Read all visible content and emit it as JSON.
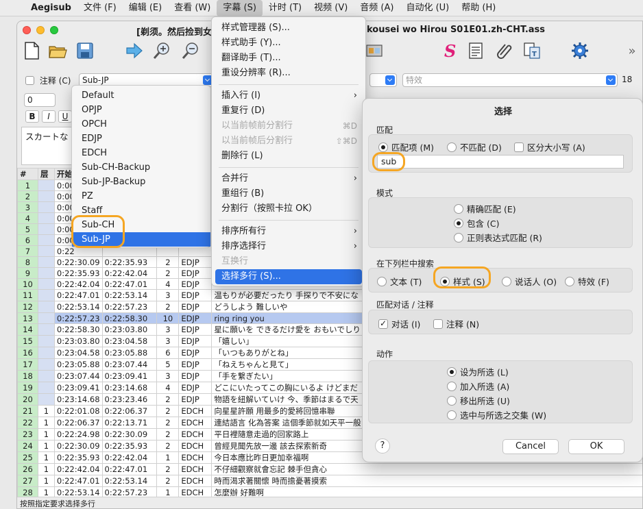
{
  "menubar": {
    "items": [
      "Aegisub",
      "文件 (F)",
      "编辑 (E)",
      "查看 (W)",
      "字幕 (S)",
      "计时 (T)",
      "视频 (V)",
      "音频 (A)",
      "自动化 (U)",
      "帮助 (H)"
    ]
  },
  "window": {
    "title_left": "[剃须。然后捡到女",
    "title_right": "kousei wo Hirou S01E01.zh-CHT.ass"
  },
  "editor": {
    "comment_label": "注释 (C)",
    "style_value": "Sub-JP",
    "effect_placeholder": "特效",
    "margin_value": "18",
    "layer_value": "0",
    "bold_label": "B",
    "italic_label": "I",
    "underline_label": "U",
    "text_preview": "スカートな"
  },
  "style_dropdown": {
    "options": [
      "Default",
      "OPJP",
      "OPCH",
      "EDJP",
      "EDCH",
      "Sub-CH-Backup",
      "Sub-JP-Backup",
      "PZ",
      "Staff",
      "Sub-CH",
      "Sub-JP"
    ],
    "selected": "Sub-JP"
  },
  "subtitle_menu": {
    "items": [
      {
        "label": "样式管理器 (S)..."
      },
      {
        "label": "样式助手 (Y)..."
      },
      {
        "label": "翻译助手 (T)..."
      },
      {
        "label": "重设分辨率 (R)..."
      },
      {
        "label": "插入行 (I)"
      },
      {
        "label": "重复行 (D)"
      },
      {
        "label": "以当前帧前分割行",
        "shortcut": "⌘D"
      },
      {
        "label": "以当前帧后分割行",
        "shortcut": "⇧⌘D"
      },
      {
        "label": "删除行 (L)"
      },
      {
        "label": "合并行"
      },
      {
        "label": "重组行 (B)"
      },
      {
        "label": "分割行（按照卡拉 OK）"
      },
      {
        "label": "排序所有行"
      },
      {
        "label": "排序选择行"
      },
      {
        "label": "互换行"
      },
      {
        "label": "选择多行 (S)..."
      }
    ]
  },
  "grid": {
    "headers": [
      "#",
      "层",
      "开始"
    ],
    "rows": [
      {
        "n": "1",
        "layer": "",
        "start": "0:00",
        "end": "",
        "dur": "",
        "style": "",
        "text": ""
      },
      {
        "n": "2",
        "layer": "",
        "start": "0:00",
        "end": "",
        "dur": "",
        "style": "",
        "text": ""
      },
      {
        "n": "3",
        "layer": "",
        "start": "0:00",
        "end": "",
        "dur": "",
        "style": "",
        "text": ""
      },
      {
        "n": "4",
        "layer": "",
        "start": "0:00",
        "end": "",
        "dur": "",
        "style": "",
        "text": ""
      },
      {
        "n": "5",
        "layer": "",
        "start": "0:00",
        "end": "",
        "dur": "",
        "style": "",
        "text": ""
      },
      {
        "n": "6",
        "layer": "",
        "start": "0:00",
        "end": "",
        "dur": "",
        "style": "",
        "text": ""
      },
      {
        "n": "7",
        "layer": "",
        "start": "0:22",
        "end": "",
        "dur": "",
        "style": "",
        "text": ""
      },
      {
        "n": "8",
        "layer": "",
        "start": "0:22:30.09",
        "end": "0:22:35.93",
        "dur": "2",
        "style": "EDJP",
        "text": ""
      },
      {
        "n": "9",
        "layer": "",
        "start": "0:22:35.93",
        "end": "0:22:42.04",
        "dur": "2",
        "style": "EDJP",
        "text": ""
      },
      {
        "n": "10",
        "layer": "",
        "start": "0:22:42.04",
        "end": "0:22:47.01",
        "dur": "4",
        "style": "EDJP",
        "text": ""
      },
      {
        "n": "11",
        "layer": "",
        "start": "0:22:47.01",
        "end": "0:22:53.14",
        "dur": "3",
        "style": "EDJP",
        "text": "温もりが必要だったり 手探りで不安にな"
      },
      {
        "n": "12",
        "layer": "",
        "start": "0:22:53.14",
        "end": "0:22:57.23",
        "dur": "2",
        "style": "EDJP",
        "text": "どうしよう 難しいや"
      },
      {
        "n": "13",
        "layer": "",
        "start": "0:22:57.23",
        "end": "0:22:58.30",
        "dur": "10",
        "style": "EDJP",
        "text": "ring ring you"
      },
      {
        "n": "14",
        "layer": "",
        "start": "0:22:58.30",
        "end": "0:23:03.80",
        "dur": "3",
        "style": "EDJP",
        "text": "星に願いを できるだけ愛を おもいでしり"
      },
      {
        "n": "15",
        "layer": "",
        "start": "0:23:03.80",
        "end": "0:23:04.58",
        "dur": "3",
        "style": "EDJP",
        "text": "「嬉しい」"
      },
      {
        "n": "16",
        "layer": "",
        "start": "0:23:04.58",
        "end": "0:23:05.88",
        "dur": "6",
        "style": "EDJP",
        "text": "「いつもありがとね」"
      },
      {
        "n": "17",
        "layer": "",
        "start": "0:23:05.88",
        "end": "0:23:07.44",
        "dur": "5",
        "style": "EDJP",
        "text": "「ねえちゃんと見て」"
      },
      {
        "n": "18",
        "layer": "",
        "start": "0:23:07.44",
        "end": "0:23:09.41",
        "dur": "3",
        "style": "EDJP",
        "text": "「手を繋ぎたい」"
      },
      {
        "n": "19",
        "layer": "",
        "start": "0:23:09.41",
        "end": "0:23:14.68",
        "dur": "4",
        "style": "EDJP",
        "text": "どこにいたってこの胸にいるよ けどまだ"
      },
      {
        "n": "20",
        "layer": "",
        "start": "0:23:14.68",
        "end": "0:23:23.46",
        "dur": "2",
        "style": "EDJP",
        "text": "物語を紐解いていけ 今、季節はまるで天"
      },
      {
        "n": "21",
        "layer": "1",
        "start": "0:22:01.08",
        "end": "0:22:06.37",
        "dur": "2",
        "style": "EDCH",
        "text": "向星星許願 用最多的愛將回憶串聯"
      },
      {
        "n": "22",
        "layer": "1",
        "start": "0:22:06.37",
        "end": "0:22:13.71",
        "dur": "2",
        "style": "EDCH",
        "text": "連結語言 化為答案 這個季節就如天平一般"
      },
      {
        "n": "23",
        "layer": "1",
        "start": "0:22:24.98",
        "end": "0:22:30.09",
        "dur": "2",
        "style": "EDCH",
        "text": "平日裡隨意走過的回家路上"
      },
      {
        "n": "24",
        "layer": "1",
        "start": "0:22:30.09",
        "end": "0:22:35.93",
        "dur": "2",
        "style": "EDCH",
        "text": "曾經見聞先放一邊 該去探索新奇"
      },
      {
        "n": "25",
        "layer": "1",
        "start": "0:22:35.93",
        "end": "0:22:42.04",
        "dur": "1",
        "style": "EDCH",
        "text": "今日本應比昨日更加幸福啊"
      },
      {
        "n": "26",
        "layer": "1",
        "start": "0:22:42.04",
        "end": "0:22:47.01",
        "dur": "2",
        "style": "EDCH",
        "text": "不仔細觀察就會忘記 棘手但貪心"
      },
      {
        "n": "27",
        "layer": "1",
        "start": "0:22:47.01",
        "end": "0:22:53.14",
        "dur": "2",
        "style": "EDCH",
        "text": "時而渴求著關懷 時而擔憂著摸索"
      },
      {
        "n": "28",
        "layer": "1",
        "start": "0:22:53.14",
        "end": "0:22:57.23",
        "dur": "1",
        "style": "EDCH",
        "text": "怎麼辦 好難啊"
      },
      {
        "n": "29",
        "layer": "1",
        "start": "0:22:57.23",
        "end": "0:22:58.30",
        "dur": "10",
        "style": "EDCH",
        "text": "ring ring you"
      }
    ]
  },
  "statusbar": {
    "text": "按照指定要求选择多行"
  },
  "dialog": {
    "title": "选择",
    "match_group": "匹配",
    "match_matches": "匹配项 (M)",
    "match_not": "不匹配 (D)",
    "case_sensitive": "区分大小写 (A)",
    "search_value": "sub",
    "mode_group": "模式",
    "mode_exact": "精确匹配 (E)",
    "mode_contains": "包含 (C)",
    "mode_regex": "正则表达式匹配 (R)",
    "field_group": "在下列栏中搜索",
    "field_text": "文本 (T)",
    "field_style": "样式 (S)",
    "field_actor": "说话人 (O)",
    "field_effect": "特效 (F)",
    "dialogue_group": "匹配对话 / 注释",
    "dialogue_label": "对话 (I)",
    "comments_label": "注释 (N)",
    "action_group": "动作",
    "action_set": "设为所选 (L)",
    "action_add": "加入所选 (A)",
    "action_remove": "移出所选 (U)",
    "action_intersect": "选中与所选之交集 (W)",
    "help_label": "?",
    "cancel_label": "Cancel",
    "ok_label": "OK"
  }
}
